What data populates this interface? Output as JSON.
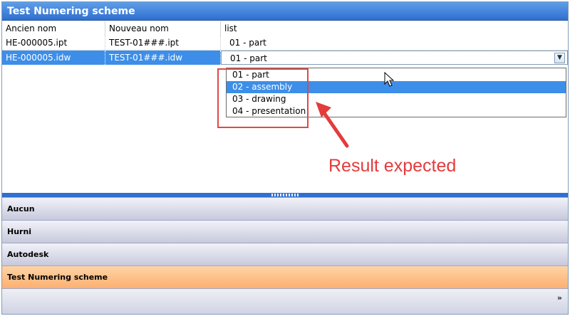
{
  "window": {
    "title": "Test Numering scheme"
  },
  "grid": {
    "columns": [
      "Ancien nom",
      "Nouveau nom",
      "list"
    ],
    "rows": [
      {
        "old": "HE-000005.ipt",
        "new": "TEST-01###.ipt",
        "list": "01 - part"
      },
      {
        "old": "HE-000005.idw",
        "new": "TEST-01###.idw",
        "list": "01 - part"
      }
    ]
  },
  "dropdown": {
    "options": [
      "01 - part",
      "02 - assembly",
      "03 - drawing",
      "04 - presentation"
    ],
    "highlighted": "02 - assembly"
  },
  "annotation": {
    "text": "Result expected",
    "color": "#e43b3b"
  },
  "nav": {
    "items": [
      "Aucun",
      "Hurni",
      "Autodesk",
      "Test Numering scheme"
    ],
    "active": "Test Numering scheme"
  },
  "colors": {
    "title_bar": "#2f6fd0",
    "selection": "#3d8ee8",
    "active_nav": "#fcb071",
    "annotation": "#e43b3b"
  }
}
